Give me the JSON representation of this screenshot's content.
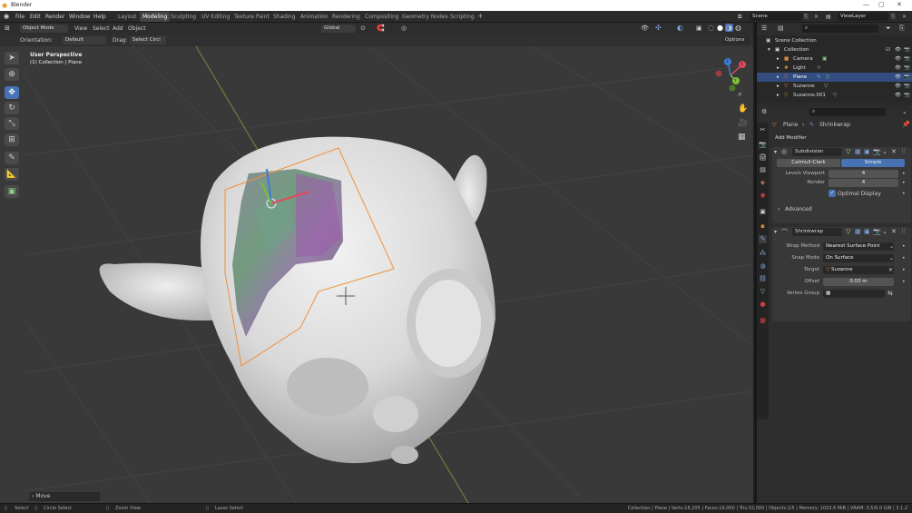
{
  "app": {
    "title": "Blender",
    "icon": "blender-logo-icon"
  },
  "menu": [
    "File",
    "Edit",
    "Render",
    "Window",
    "Help"
  ],
  "workspaces": {
    "tabs": [
      "Layout",
      "Modeling",
      "Sculpting",
      "UV Editing",
      "Texture Paint",
      "Shading",
      "Animation",
      "Rendering",
      "Compositing",
      "Geometry Nodes",
      "Scripting"
    ],
    "active": "Modeling",
    "add": "+"
  },
  "scene": {
    "scene": "Scene",
    "view_layer": "ViewLayer"
  },
  "header": {
    "mode": "Object Mode",
    "view": "View",
    "select": "Select",
    "add": "Add",
    "object": "Object",
    "transform": "Global",
    "options": "Options"
  },
  "header2": {
    "orientation_label": "Orientation:",
    "orientation": "Default",
    "drag_label": "Drag:",
    "drag": "Select Circl"
  },
  "viewport": {
    "view_name": "User Perspective",
    "collection_info": "(1) Collection | Plane",
    "axis": {
      "x": "X",
      "y": "Y",
      "z": "Z"
    }
  },
  "operator_panel": "Move",
  "outliner": {
    "root": "Scene Collection",
    "collection": "Collection",
    "items": [
      {
        "name": "Camera",
        "type": "camera-icon",
        "selected": false
      },
      {
        "name": "Light",
        "type": "light-icon",
        "selected": false
      },
      {
        "name": "Plane",
        "type": "mesh-icon",
        "selected": true
      },
      {
        "name": "Suzanne",
        "type": "mesh-icon",
        "selected": false
      },
      {
        "name": "Suzanne.001",
        "type": "mesh-icon",
        "selected": false
      }
    ]
  },
  "properties": {
    "breadcrumb_object": "Plane",
    "breadcrumb_modifier": "Shrinkwrap",
    "add_modifier": "Add Modifier",
    "subdivision": {
      "name": "Subdivision",
      "mode_a": "Catmull-Clark",
      "mode_b": "Simple",
      "levels_label": "Levels Viewport",
      "levels": "4",
      "render_label": "Render",
      "render": "4",
      "optimal_label": "Optimal Display",
      "advanced": "Advanced"
    },
    "shrinkwrap": {
      "name": "Shrinkwrap",
      "wrap_method_label": "Wrap Method",
      "wrap_method": "Nearest Surface Point",
      "snap_mode_label": "Snap Mode",
      "snap_mode": "On Surface",
      "target_label": "Target",
      "target": "Suzanne",
      "offset_label": "Offset",
      "offset": "0.03 m",
      "vertex_group_label": "Vertex Group"
    }
  },
  "status": {
    "select": "Select",
    "circle_select": "Circle Select",
    "zoom_view": "Zoom View",
    "lasso_select": "Lasso Select",
    "stats": "Collection | Plane | Verts:16,205 | Faces:16,000 | Tris:32,000 | Objects:1/5 | Memory: 1010.6 MiB | VRAM: 3.5/6.0 GiB | 3.1.2"
  },
  "colors": {
    "accent": "#4772b3",
    "selection_outline": "#f0913a",
    "viewport_bg": "#393939",
    "grid": "#444444"
  }
}
